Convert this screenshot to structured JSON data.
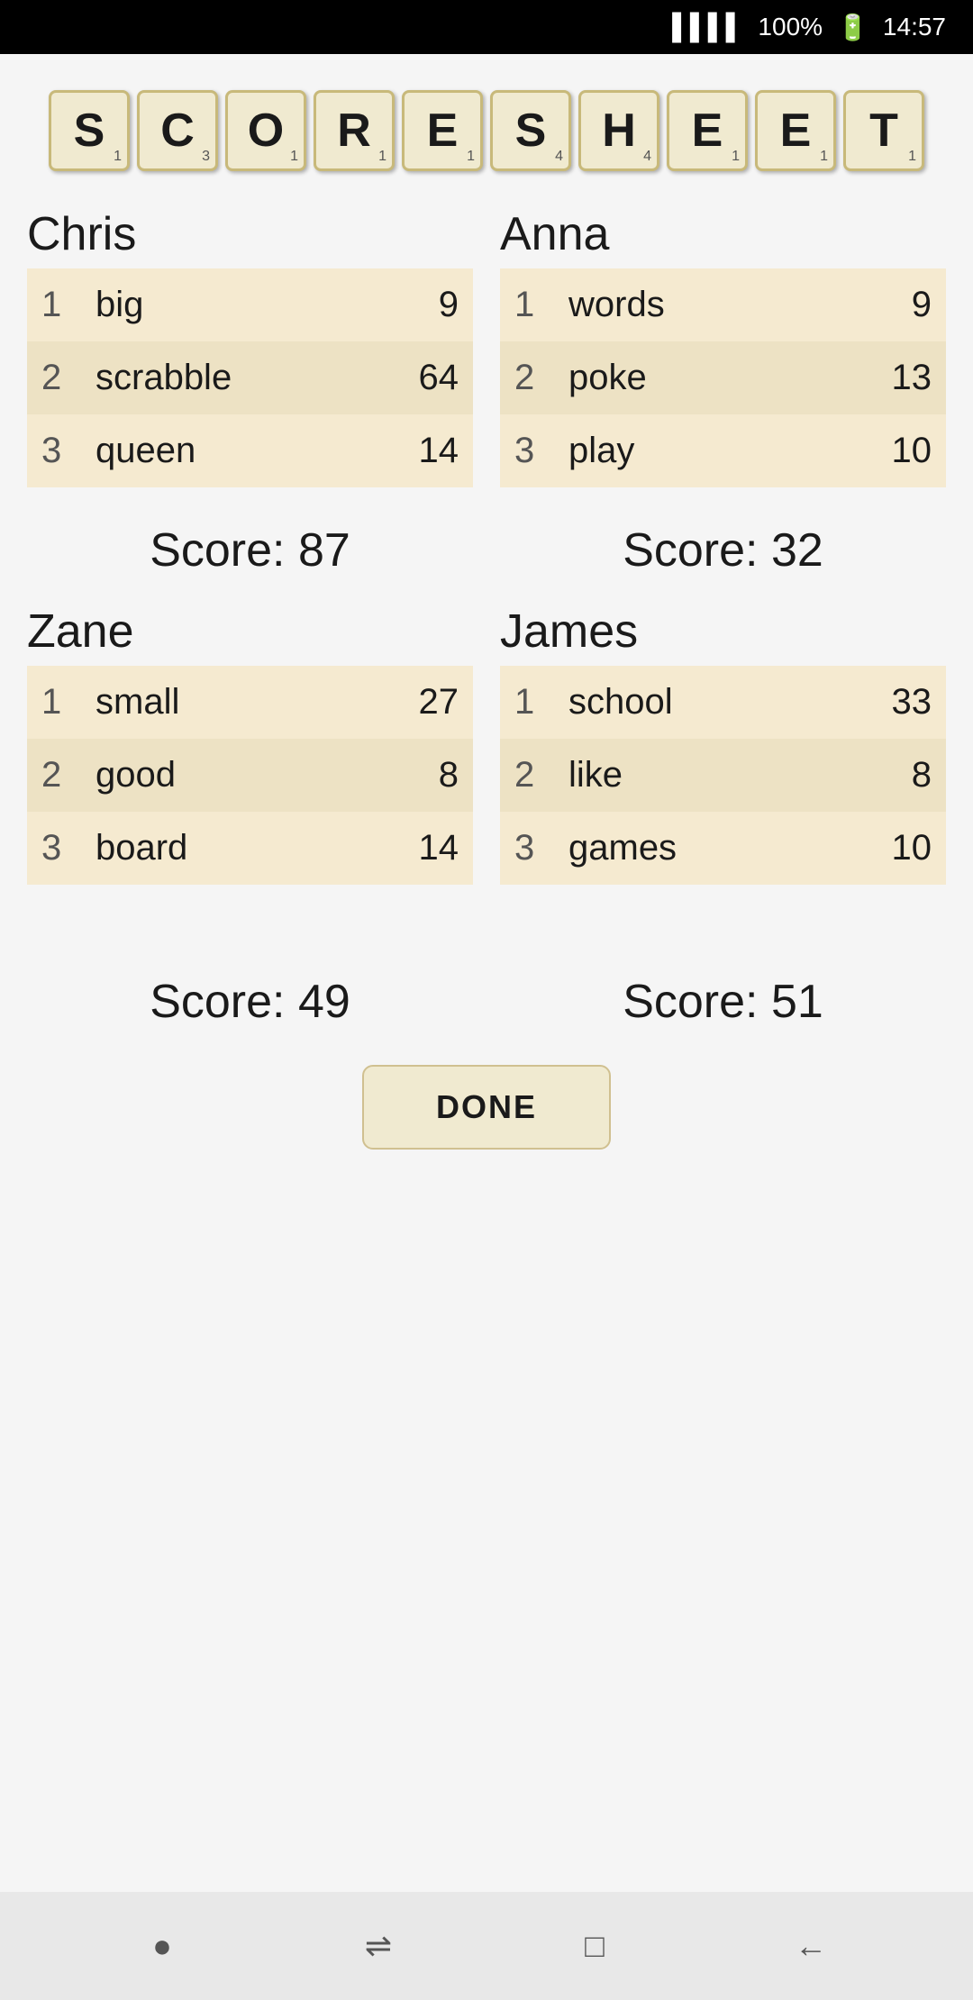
{
  "statusBar": {
    "signal": "▌▌▌▌",
    "battery": "100%",
    "batteryIcon": "🔋",
    "time": "14:57"
  },
  "title": {
    "letters": [
      {
        "char": "S",
        "num": "1"
      },
      {
        "char": "C",
        "num": "3"
      },
      {
        "char": "O",
        "num": "1"
      },
      {
        "char": "R",
        "num": "1"
      },
      {
        "char": "E",
        "num": "1"
      },
      {
        "char": "S",
        "num": "4"
      },
      {
        "char": "H",
        "num": "4"
      },
      {
        "char": "E",
        "num": "1"
      },
      {
        "char": "E",
        "num": "1"
      },
      {
        "char": "T",
        "num": "1"
      }
    ]
  },
  "players": [
    {
      "name": "Chris",
      "plays": [
        {
          "num": 1,
          "word": "big",
          "score": 9
        },
        {
          "num": 2,
          "word": "scrabble",
          "score": 64
        },
        {
          "num": 3,
          "word": "queen",
          "score": 14
        }
      ],
      "total": "Score: 87"
    },
    {
      "name": "Anna",
      "plays": [
        {
          "num": 1,
          "word": "words",
          "score": 9
        },
        {
          "num": 2,
          "word": "poke",
          "score": 13
        },
        {
          "num": 3,
          "word": "play",
          "score": 10
        }
      ],
      "total": "Score: 32"
    },
    {
      "name": "Zane",
      "plays": [
        {
          "num": 1,
          "word": "small",
          "score": 27
        },
        {
          "num": 2,
          "word": "good",
          "score": 8
        },
        {
          "num": 3,
          "word": "board",
          "score": 14
        }
      ],
      "total": "Score: 49"
    },
    {
      "name": "James",
      "plays": [
        {
          "num": 1,
          "word": "school",
          "score": 33
        },
        {
          "num": 2,
          "word": "like",
          "score": 8
        },
        {
          "num": 3,
          "word": "games",
          "score": 10
        }
      ],
      "total": "Score: 51"
    }
  ],
  "doneButton": "DONE",
  "nav": {
    "homeIcon": "●",
    "menuIcon": "⇌",
    "squareIcon": "□",
    "backIcon": "←"
  }
}
